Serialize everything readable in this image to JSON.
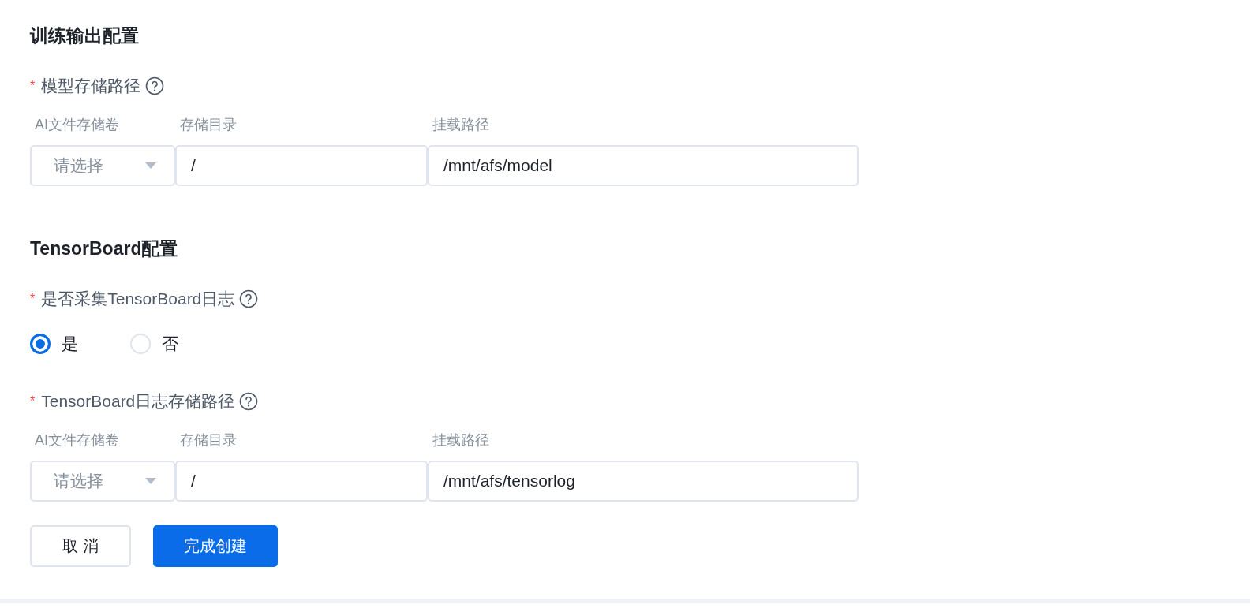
{
  "sections": [
    {
      "title": "训练输出配置",
      "fields": [
        {
          "kind": "path",
          "label": "模型存储路径",
          "required_mark": "*",
          "columns": [
            "AI文件存储卷",
            "存储目录",
            "挂载路径"
          ],
          "volume": {
            "placeholder": "请选择"
          },
          "directory": "/",
          "mount": "/mnt/afs/model"
        }
      ]
    },
    {
      "title": "TensorBoard配置",
      "fields": [
        {
          "kind": "radio",
          "label": "是否采集TensorBoard日志",
          "required_mark": "*",
          "options": [
            {
              "label": "是",
              "selected": true
            },
            {
              "label": "否",
              "selected": false
            }
          ]
        },
        {
          "kind": "path",
          "label": "TensorBoard日志存储路径",
          "required_mark": "*",
          "columns": [
            "AI文件存储卷",
            "存储目录",
            "挂载路径"
          ],
          "volume": {
            "placeholder": "请选择"
          },
          "directory": "/",
          "mount": "/mnt/afs/tensorlog"
        }
      ]
    }
  ],
  "buttons": [
    {
      "label": "取 消",
      "kind": "secondary"
    },
    {
      "label": "完成创建",
      "kind": "primary"
    }
  ]
}
